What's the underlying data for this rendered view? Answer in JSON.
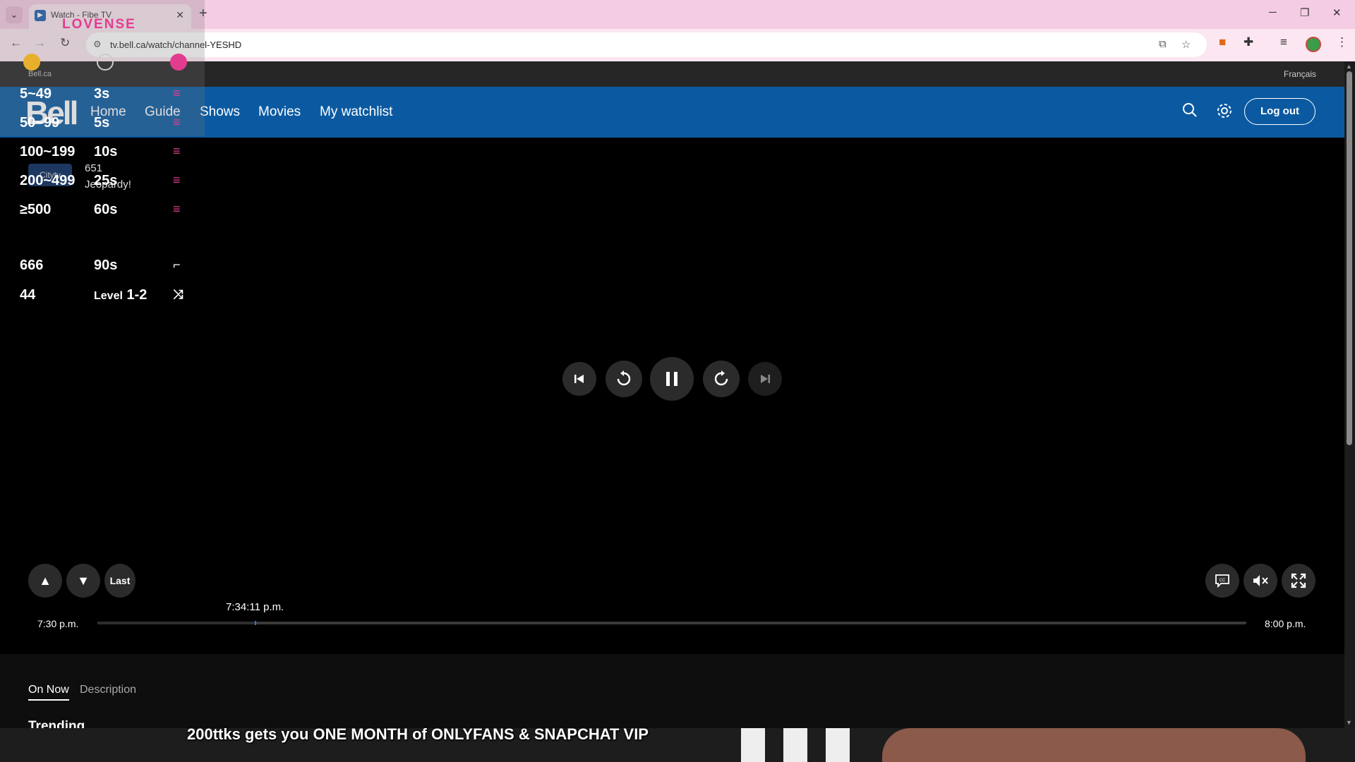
{
  "browser": {
    "tab_title": "Watch - Fibe TV",
    "url": "tv.bell.ca/watch/channel-YESHD",
    "minimize": "─",
    "maximize": "❐",
    "close": "✕"
  },
  "site": {
    "util_link": "Bell.ca",
    "language": "Français",
    "logo": "Bell",
    "nav": [
      "Home",
      "Guide",
      "Shows",
      "Movies",
      "My watchlist"
    ],
    "logout_label": "Log out"
  },
  "player": {
    "start_time": "7:30 p.m.",
    "end_time": "8:00 p.m.",
    "current_time": "7:34:11 p.m.",
    "progress": 0.137,
    "last_label": "Last"
  },
  "info": {
    "tabs": [
      "On Now",
      "Description"
    ],
    "section_heading": "Trending"
  },
  "overlay": {
    "brand": "LOVENSE",
    "tip_rows": [
      {
        "amount": "5~49",
        "duration": "3s"
      },
      {
        "amount": "50~99",
        "duration": "5s"
      },
      {
        "amount": "100~199",
        "duration": "10s"
      },
      {
        "amount": "200~499",
        "duration": "25s"
      },
      {
        "amount": "≥500",
        "duration": "60s"
      }
    ],
    "special_rows": [
      {
        "amount": "666",
        "duration": "90s"
      },
      {
        "amount": "44",
        "level_word": "Level",
        "level_value": "1-2"
      }
    ],
    "channel_logo": "Citytv",
    "channel_number": "651",
    "channel_show": "Jeopardy!",
    "promo_text": "200ttks gets you ONE MONTH of ONLYFANS & SNAPCHAT VIP"
  }
}
